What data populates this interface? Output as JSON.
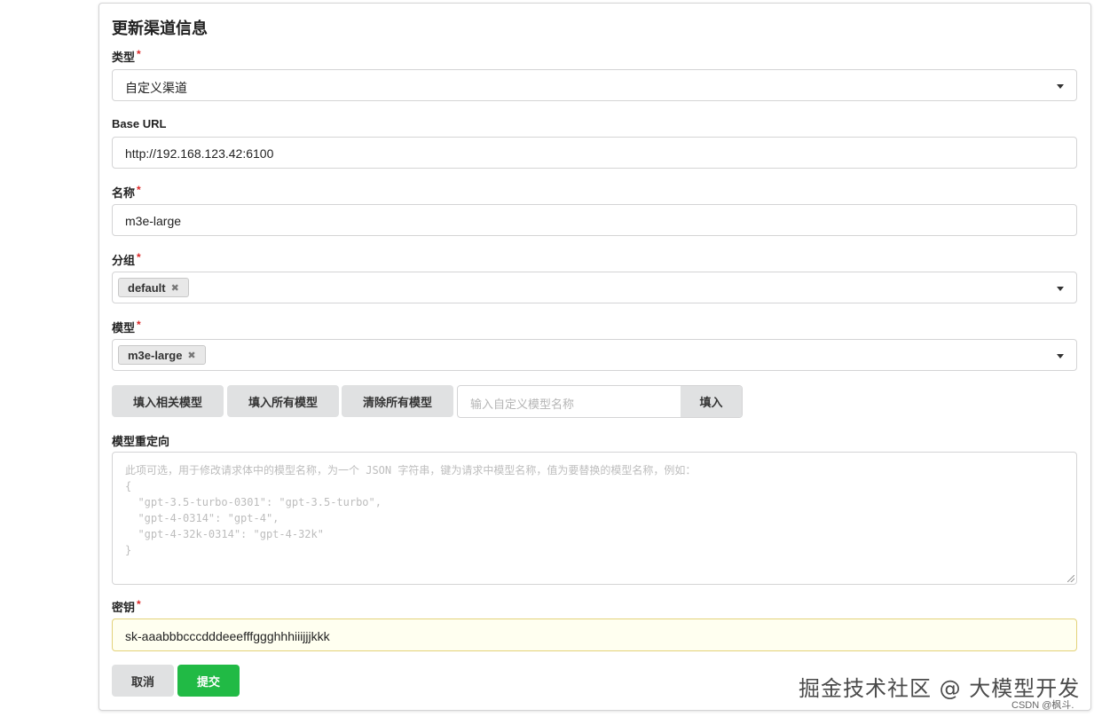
{
  "form": {
    "title": "更新渠道信息",
    "required_mark": "*",
    "type": {
      "label": "类型",
      "value": "自定义渠道"
    },
    "base_url": {
      "label": "Base URL",
      "value": "http://192.168.123.42:6100"
    },
    "name": {
      "label": "名称",
      "value": "m3e-large"
    },
    "group": {
      "label": "分组",
      "chips": [
        "default"
      ]
    },
    "models": {
      "label": "模型",
      "chips": [
        "m3e-large"
      ]
    },
    "model_buttons": {
      "fill_related": "填入相关模型",
      "fill_all": "填入所有模型",
      "clear_all": "清除所有模型",
      "custom_placeholder": "输入自定义模型名称",
      "fill": "填入"
    },
    "redirect": {
      "label": "模型重定向",
      "placeholder": "此项可选，用于修改请求体中的模型名称，为一个 JSON 字符串，键为请求中模型名称，值为要替换的模型名称，例如：\n{\n  \"gpt-3.5-turbo-0301\": \"gpt-3.5-turbo\",\n  \"gpt-4-0314\": \"gpt-4\",\n  \"gpt-4-32k-0314\": \"gpt-4-32k\"\n}"
    },
    "secret": {
      "label": "密钥",
      "value": "sk-aaabbbcccdddeeefffggghhhiiijjjkkk"
    },
    "cancel": "取消",
    "submit": "提交"
  },
  "watermark": {
    "main": "掘金技术社区 @ 大模型开发",
    "sub": "CSDN @枫斗."
  },
  "colors": {
    "submit": "#21ba45",
    "required": "#db2828"
  },
  "icons": {
    "remove_chip": "close-icon",
    "dropdown": "caret-down-icon"
  }
}
